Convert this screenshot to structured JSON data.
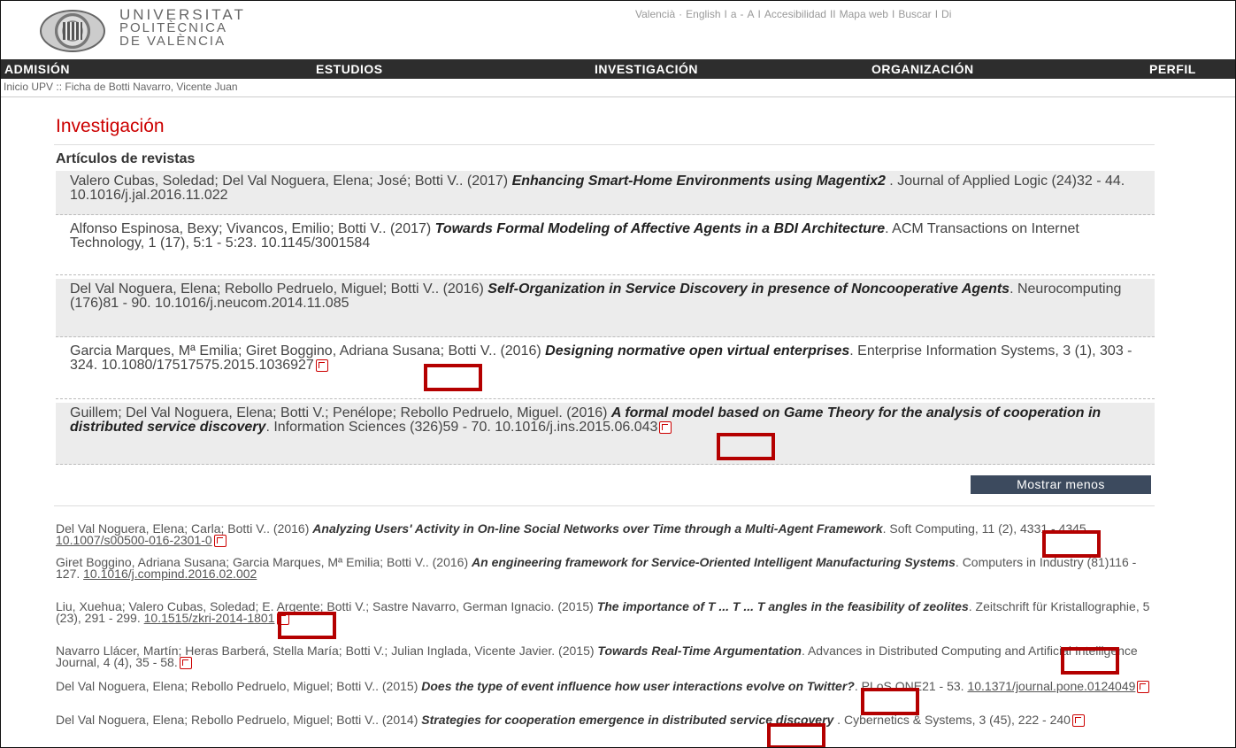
{
  "header": {
    "logo_lines": [
      "UNIVERSITAT",
      "POLITÈCNICA",
      "DE VALÈNCIA"
    ],
    "top_links": [
      "Valencià",
      "English",
      "a",
      "A",
      "Accesibilidad",
      "Mapa web",
      "Buscar",
      "Di"
    ]
  },
  "nav": [
    "ADMISIÓN",
    "ESTUDIOS",
    "INVESTIGACIÓN",
    "ORGANIZACIÓN",
    "PERFIL"
  ],
  "breadcrumb": "Inicio UPV :: Ficha de Botti Navarro, Vicente Juan",
  "section_title": "Investigación",
  "sub_title": "Artículos de revistas",
  "articles": [
    {
      "pre": "Valero Cubas, Soledad; Del Val Noguera, Elena; José; Botti V.. (2017) ",
      "title": "Enhancing Smart-Home Environments using Magentix2",
      "post": " . Journal of Applied Logic (24)32 - 44. 10.1016/j.jal.2016.11.022"
    },
    {
      "pre": "Alfonso Espinosa, Bexy; Vivancos, Emilio; Botti V.. (2017) ",
      "title": "Towards Formal Modeling of Affective Agents in a BDI Architecture",
      "post": ". ACM Transactions on Internet Technology, 1 (17), 5:1 - 5:23. 10.1145/3001584"
    },
    {
      "pre": "Del Val Noguera, Elena; Rebollo Pedruelo, Miguel; Botti V.. (2016) ",
      "title": "Self-Organization in Service Discovery in presence of Noncooperative Agents",
      "post": ". Neurocomputing (176)81 - 90. 10.1016/j.neucom.2014.11.085"
    },
    {
      "pre": "Garcia Marques, Mª Emilia; Giret Boggino, Adriana Susana; Botti V.. (2016) ",
      "title": "Designing normative open virtual enterprises",
      "post": ". Enterprise Information Systems, 3 (1), 303 - 324. 10.1080/17517575.2015.1036927"
    },
    {
      "pre": "Guillem; Del Val Noguera, Elena; Botti V.; Penélope; Rebollo Pedruelo, Miguel. (2016) ",
      "title": "A formal model based on Game Theory for the analysis of cooperation in distributed service discovery",
      "post": ". Information Sciences (326)59 - 70. 10.1016/j.ins.2015.06.043"
    }
  ],
  "show_less_label": "Mostrar menos",
  "entries": [
    {
      "pre": "Del Val Noguera, Elena; Carla; Botti V.. (2016) ",
      "title": "Analyzing Users' Activity in On-line Social Networks over Time through a Multi-Agent Framework",
      "post": ". Soft Computing, 11 (2), 4331 - 4345. ",
      "doi": "10.1007/s00500-016-2301-0"
    },
    {
      "pre": "Giret Boggino, Adriana Susana; Garcia Marques, Mª Emilia; Botti V.. (2016) ",
      "title": "An engineering framework for Service-Oriented Intelligent Manufacturing Systems",
      "post": ". Computers in Industry (81)116 - 127. ",
      "doi": "10.1016/j.compind.2016.02.002"
    },
    {
      "pre": "Liu, Xuehua; Valero Cubas, Soledad; E. Argente; Botti V.; Sastre Navarro, German Ignacio. (2015) ",
      "title": "The importance of T ... T ... T angles in the feasibility of zeolites",
      "post": ". Zeitschrift für Kristallographie, 5 (23), 291 - 299. ",
      "doi": "10.1515/zkri-2014-1801"
    },
    {
      "pre": "Navarro Llácer, Martín; Heras Barberá, Stella María; Botti V.; Julian Inglada, Vicente Javier. (2015) ",
      "title": "Towards Real-Time Argumentation",
      "post": ". Advances in Distributed Computing and Artificial Intelligence Journal, 4 (4), 35 - 58.",
      "doi": ""
    },
    {
      "pre": "Del Val Noguera, Elena; Rebollo Pedruelo, Miguel; Botti V.. (2015) ",
      "title": "Does the type of event influence how user interactions evolve on Twitter?",
      "post": ". PLoS ONE21 - 53. ",
      "doi": "10.1371/journal.pone.0124049"
    },
    {
      "pre": "Del Val Noguera, Elena; Rebollo Pedruelo, Miguel; Botti V.. (2014) ",
      "title": "Strategies for cooperation emergence in distributed service discovery",
      "post": " . Cybernetics & Systems, 3 (45), 222 - 240",
      "doi": ""
    }
  ]
}
